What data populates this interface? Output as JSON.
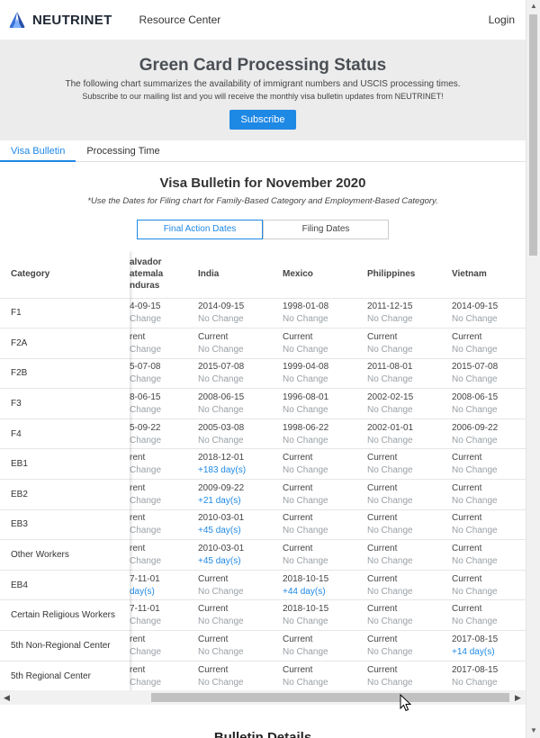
{
  "nav": {
    "brand": "NEUTRINET",
    "resource": "Resource Center",
    "login": "Login"
  },
  "hero": {
    "title": "Green Card Processing Status",
    "desc": "The following chart summarizes the availability of immigrant numbers and USCIS processing times.",
    "desc2": "Subscribe to our mailing list and you will receive the monthly visa bulletin updates from NEUTRINET!",
    "subscribe": "Subscribe"
  },
  "tabs": [
    "Visa Bulletin",
    "Processing Time"
  ],
  "section": {
    "title": "Visa Bulletin for November 2020",
    "note": "*Use the Dates for Filing chart for Family-Based Category and Employment-Based Category.",
    "toggle": [
      "Final Action Dates",
      "Filing Dates"
    ]
  },
  "table": {
    "headers": {
      "category": "Category",
      "es_line1": "alvador",
      "es_line2": "atemala",
      "es_line3": "nduras",
      "india": "India",
      "mexico": "Mexico",
      "philippines": "Philippines",
      "vietnam": "Vietnam"
    },
    "rows": [
      {
        "cat": "F1",
        "es": [
          "4-09-15",
          "Change"
        ],
        "in": [
          "2014-09-15",
          "No Change"
        ],
        "mx": [
          "1998-01-08",
          "No Change"
        ],
        "ph": [
          "2011-12-15",
          "No Change"
        ],
        "vn": [
          "2014-09-15",
          "No Change"
        ]
      },
      {
        "cat": "F2A",
        "es": [
          "rent",
          "Change"
        ],
        "in": [
          "Current",
          "No Change"
        ],
        "mx": [
          "Current",
          "No Change"
        ],
        "ph": [
          "Current",
          "No Change"
        ],
        "vn": [
          "Current",
          "No Change"
        ]
      },
      {
        "cat": "F2B",
        "es": [
          "5-07-08",
          "Change"
        ],
        "in": [
          "2015-07-08",
          "No Change"
        ],
        "mx": [
          "1999-04-08",
          "No Change"
        ],
        "ph": [
          "2011-08-01",
          "No Change"
        ],
        "vn": [
          "2015-07-08",
          "No Change"
        ]
      },
      {
        "cat": "F3",
        "es": [
          "8-06-15",
          "Change"
        ],
        "in": [
          "2008-06-15",
          "No Change"
        ],
        "mx": [
          "1996-08-01",
          "No Change"
        ],
        "ph": [
          "2002-02-15",
          "No Change"
        ],
        "vn": [
          "2008-06-15",
          "No Change"
        ]
      },
      {
        "cat": "F4",
        "es": [
          "5-09-22",
          "Change"
        ],
        "in": [
          "2005-03-08",
          "No Change"
        ],
        "mx": [
          "1998-06-22",
          "No Change"
        ],
        "ph": [
          "2002-01-01",
          "No Change"
        ],
        "vn": [
          "2006-09-22",
          "No Change"
        ]
      },
      {
        "cat": "EB1",
        "es": [
          "rent",
          "Change"
        ],
        "in": [
          "2018-12-01",
          "+183 day(s)"
        ],
        "mx": [
          "Current",
          "No Change"
        ],
        "ph": [
          "Current",
          "No Change"
        ],
        "vn": [
          "Current",
          "No Change"
        ]
      },
      {
        "cat": "EB2",
        "es": [
          "rent",
          "Change"
        ],
        "in": [
          "2009-09-22",
          "+21 day(s)"
        ],
        "mx": [
          "Current",
          "No Change"
        ],
        "ph": [
          "Current",
          "No Change"
        ],
        "vn": [
          "Current",
          "No Change"
        ]
      },
      {
        "cat": "EB3",
        "es": [
          "rent",
          "Change"
        ],
        "in": [
          "2010-03-01",
          "+45 day(s)"
        ],
        "mx": [
          "Current",
          "No Change"
        ],
        "ph": [
          "Current",
          "No Change"
        ],
        "vn": [
          "Current",
          "No Change"
        ]
      },
      {
        "cat": "Other Workers",
        "es": [
          "rent",
          "Change"
        ],
        "in": [
          "2010-03-01",
          "+45 day(s)"
        ],
        "mx": [
          "Current",
          "No Change"
        ],
        "ph": [
          "Current",
          "No Change"
        ],
        "vn": [
          "Current",
          "No Change"
        ]
      },
      {
        "cat": "EB4",
        "es": [
          "7-11-01",
          "day(s)"
        ],
        "in": [
          "Current",
          "No Change"
        ],
        "mx": [
          "2018-10-15",
          "+44 day(s)"
        ],
        "ph": [
          "Current",
          "No Change"
        ],
        "vn": [
          "Current",
          "No Change"
        ]
      },
      {
        "cat": "Certain Religious Workers",
        "es": [
          "7-11-01",
          "Change"
        ],
        "in": [
          "Current",
          "No Change"
        ],
        "mx": [
          "2018-10-15",
          "No Change"
        ],
        "ph": [
          "Current",
          "No Change"
        ],
        "vn": [
          "Current",
          "No Change"
        ]
      },
      {
        "cat": "5th Non-Regional Center",
        "es": [
          "rent",
          "Change"
        ],
        "in": [
          "Current",
          "No Change"
        ],
        "mx": [
          "Current",
          "No Change"
        ],
        "ph": [
          "Current",
          "No Change"
        ],
        "vn": [
          "2017-08-15",
          "+14 day(s)"
        ]
      },
      {
        "cat": "5th Regional Center",
        "es": [
          "rent",
          "Change"
        ],
        "in": [
          "Current",
          "No Change"
        ],
        "mx": [
          "Current",
          "No Change"
        ],
        "ph": [
          "Current",
          "No Change"
        ],
        "vn": [
          "2017-08-15",
          "No Change"
        ]
      }
    ]
  },
  "lower": {
    "title": "Bulletin Details"
  },
  "colors": {
    "accent": "#1e88e5",
    "hero_bg": "#ececec",
    "muted": "#9aa0a6"
  },
  "icons": {
    "logo": "neutrinet-logo-icon",
    "cursor": "mouse-cursor-icon"
  }
}
